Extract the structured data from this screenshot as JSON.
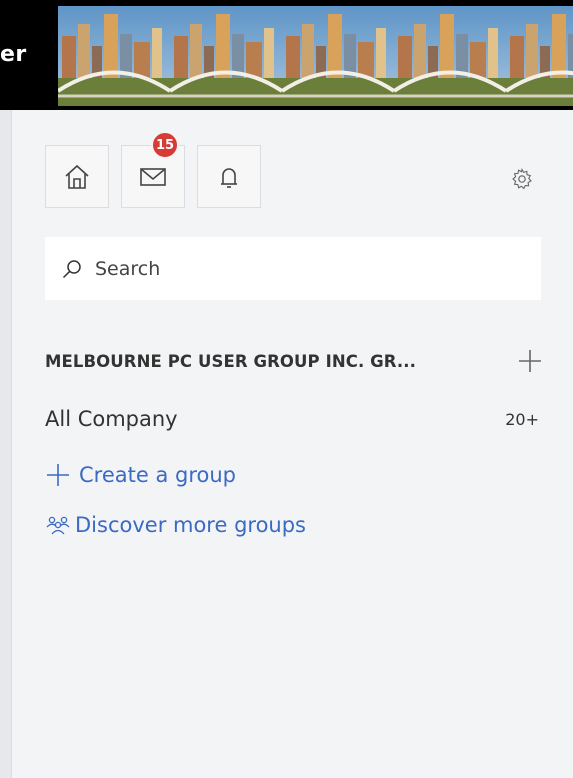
{
  "header": {
    "title_fragment": "er",
    "banner_icon": "city-skyline-bridge-banner"
  },
  "nav": {
    "home_icon": "home-icon",
    "inbox_icon": "mail-icon",
    "inbox_badge": "15",
    "notifications_icon": "bell-icon",
    "settings_icon": "gear-icon"
  },
  "search": {
    "placeholder": "Search"
  },
  "groups": {
    "section_label": "MELBOURNE PC USER GROUP INC. GR...",
    "add_icon": "plus-icon",
    "items": [
      {
        "name": "All Company",
        "count": "20+"
      }
    ]
  },
  "actions": {
    "create_label": "Create a group",
    "discover_label": "Discover more groups"
  },
  "colors": {
    "accent": "#3b6ac3",
    "badge": "#d63c35",
    "panel_bg": "#f3f4f6"
  }
}
